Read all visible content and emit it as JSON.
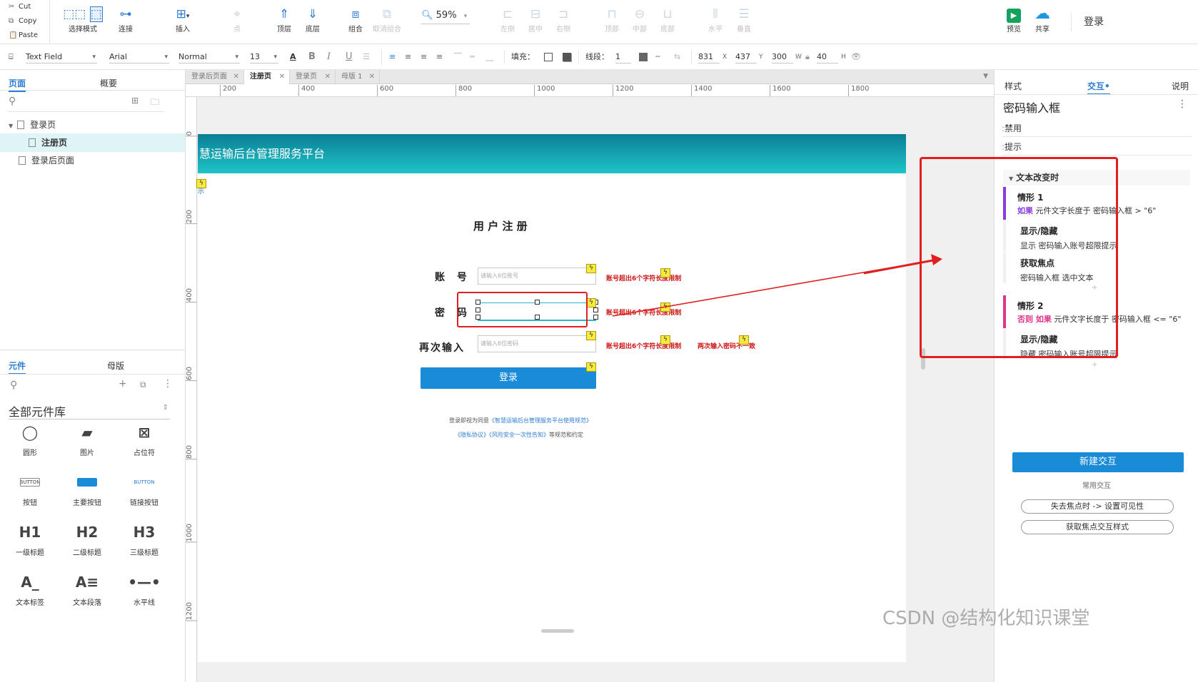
{
  "toolbar": {
    "clipboard": [
      "Cut",
      "Copy",
      "Paste"
    ],
    "buttons": {
      "select_mode": "选择模式",
      "connect": "连接",
      "insert": "插入",
      "point": "点",
      "top_layer": "顶层",
      "bottom_layer": "底层",
      "group": "组合",
      "ungroup": "取消组合",
      "zoom": "59%",
      "align_left": "左侧",
      "align_center": "居中",
      "align_right": "右侧",
      "align_top": "顶部",
      "align_middle": "中部",
      "align_bottom": "底部",
      "dist_horizontal": "水平",
      "dist_vertical": "垂直",
      "preview": "预览",
      "share": "共享",
      "login": "登录"
    }
  },
  "format": {
    "component_type": "Text Field",
    "font": "Arial",
    "weight": "Normal",
    "size": "13",
    "bold": "B",
    "italic": "I",
    "underline": "U",
    "fill_label": "填充：",
    "stroke_label": "线段：",
    "stroke_value": "1",
    "x_value": "831",
    "x_label": "X",
    "y_value": "437",
    "y_label": "Y",
    "w_value": "300",
    "w_label": "W",
    "h_value": "40",
    "h_label": "H"
  },
  "left_panel": {
    "tabs": [
      "页面",
      "概要"
    ],
    "pages": [
      "登录页",
      "注册页",
      "登录后页面"
    ],
    "widget_tabs": [
      "元件",
      "母版"
    ],
    "library_title": "全部元件库",
    "widgets": [
      {
        "label": "圆形",
        "glyph": "◯"
      },
      {
        "label": "图片",
        "glyph": "▰"
      },
      {
        "label": "占位符",
        "glyph": "⊠"
      },
      {
        "label": "按钮",
        "glyph": "BUTTON"
      },
      {
        "label": "主要按钮",
        "glyph": "BUTTON"
      },
      {
        "label": "链接按钮",
        "glyph": "BUTTON"
      },
      {
        "label": "一级标题",
        "glyph": "H1"
      },
      {
        "label": "二级标题",
        "glyph": "H2"
      },
      {
        "label": "三级标题",
        "glyph": "H3"
      },
      {
        "label": "文本标签",
        "glyph": "A_"
      },
      {
        "label": "文本段落",
        "glyph": "A≡"
      },
      {
        "label": "水平线",
        "glyph": "•—•"
      }
    ]
  },
  "doc_tabs": [
    "登录后页面",
    "注册页",
    "登录页",
    "母版 1"
  ],
  "ruler": {
    "h": [
      "200",
      "400",
      "600",
      "800",
      "1000",
      "1200",
      "1400",
      "1600",
      "1800"
    ],
    "v": [
      "0",
      "200",
      "400",
      "600",
      "800",
      "1000",
      "1200"
    ]
  },
  "page": {
    "banner_title": "慧运输后台管理服务平台",
    "fragment_text": "示",
    "form_title": "用 户 注 册",
    "account_label": "账 号",
    "password_label": "密 码",
    "confirm_label": "再次输入",
    "account_placeholder": "请输入6位账号",
    "confirm_placeholder": "请输入6位密码",
    "error_account": "账号超出6个字符长度限制",
    "error_password": "账号超出6个字符长度限制",
    "error_confirm": "账号超出6个字符长度限制",
    "error_mismatch": "两次输入密码不一致",
    "login_button": "登录",
    "agree_prefix": "登录即视为同意",
    "agree_link1": "《智慧运输后台管理服务平台使用规范》",
    "agree_link2": "《隐私协议》《风险安全一次性告知》",
    "agree_suffix": "等规范和约定"
  },
  "right_panel": {
    "tabs": [
      "样式",
      "交互",
      "说明"
    ],
    "widget_name": "密码输入框",
    "props": [
      "禁用",
      "提示"
    ],
    "event": "文本改变时",
    "case1": {
      "title": "情形 1",
      "if": "如果",
      "cond": "元件文字长度于 密码输入框 > \"6\""
    },
    "action1": {
      "title": "显示/隐藏",
      "desc": "显示 密码输入账号超限提示"
    },
    "action2": {
      "title": "获取焦点",
      "desc": "密码输入框 选中文本"
    },
    "case2": {
      "title": "情形 2",
      "if": "否则 如果",
      "cond": "元件文字长度于 密码输入框 <= \"6\""
    },
    "action3": {
      "title": "显示/隐藏",
      "desc": "隐藏 密码输入账号超限提示"
    },
    "new_interaction": "新建交互",
    "common_title": "常用交互",
    "common": [
      "失去焦点时 -> 设置可见性",
      "获取焦点交互样式"
    ]
  },
  "watermark": "CSDN @结构化知识课堂",
  "colors": {
    "accent": "#2e7dd1",
    "annotation": "#e02020",
    "case1": "#8a3be0",
    "case2": "#e0338b",
    "banner": "#0a7e95"
  }
}
